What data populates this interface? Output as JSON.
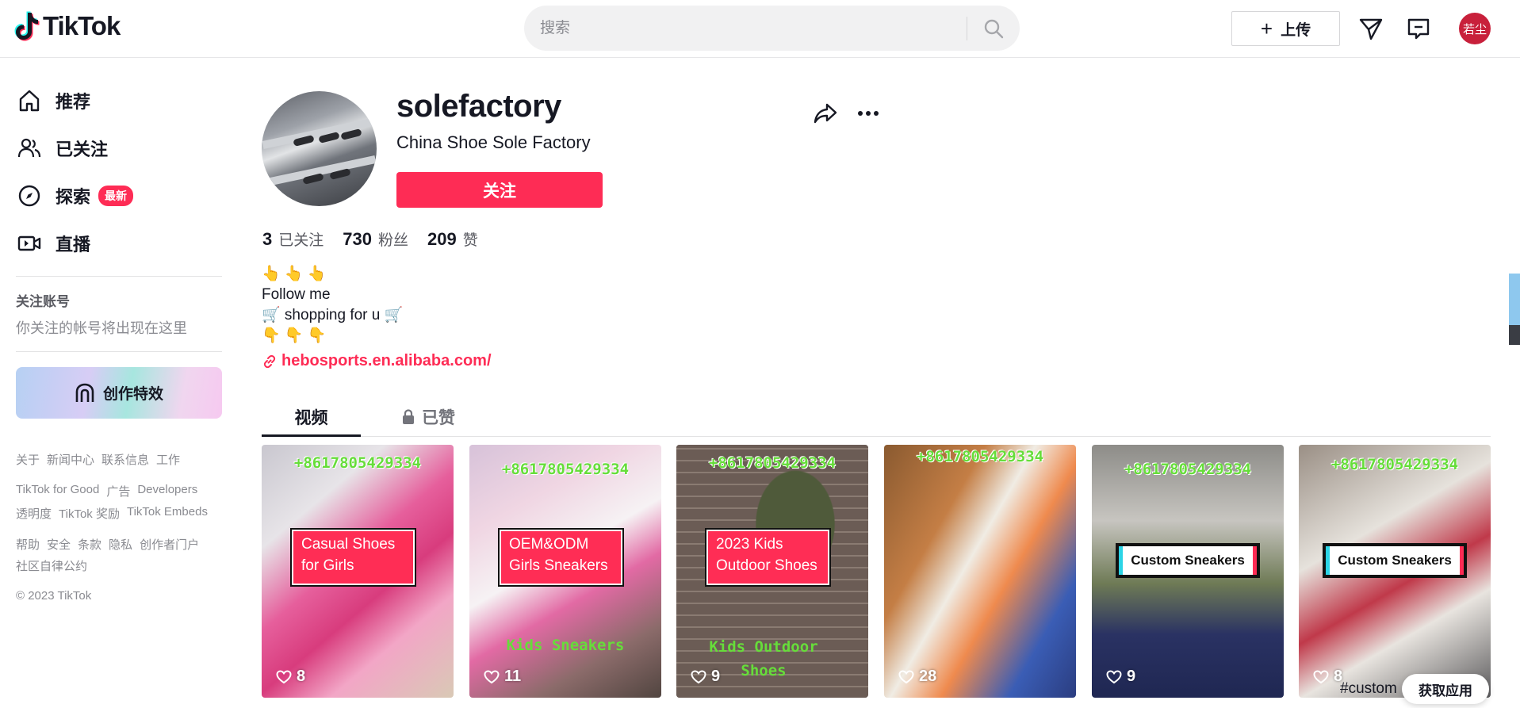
{
  "header": {
    "logo_text": "TikTok",
    "search_placeholder": "搜索",
    "upload_label": "上传",
    "user_avatar_text": "若尘"
  },
  "sidebar": {
    "nav": [
      {
        "label": "推荐",
        "icon": "home-icon"
      },
      {
        "label": "已关注",
        "icon": "following-icon"
      },
      {
        "label": "探索",
        "icon": "compass-icon",
        "badge": "最新"
      },
      {
        "label": "直播",
        "icon": "live-icon"
      }
    ],
    "following_title": "关注账号",
    "following_hint": "你关注的帐号将出现在这里",
    "effects_label": "创作特效",
    "footer_rows": [
      [
        "关于",
        "新闻中心",
        "联系信息",
        "工作"
      ],
      [
        "TikTok for Good",
        "广告",
        "Developers"
      ],
      [
        "透明度",
        "TikTok 奖励",
        "TikTok Embeds"
      ],
      [
        "帮助",
        "安全",
        "条款",
        "隐私",
        "创作者门户"
      ],
      [
        "社区自律公约"
      ]
    ],
    "copyright": "© 2023 TikTok"
  },
  "profile": {
    "username": "solefactory",
    "nickname": "China Shoe Sole Factory",
    "follow_label": "关注",
    "stats": [
      {
        "num": "3",
        "label": "已关注"
      },
      {
        "num": "730",
        "label": "粉丝"
      },
      {
        "num": "209",
        "label": "赞"
      }
    ],
    "bio_lines": [
      "👆 👆 👆",
      "Follow me",
      "🛒 shopping for u 🛒",
      "👇 👇 👇"
    ],
    "link": "hebosports.en.alibaba.com/"
  },
  "tabs": {
    "videos": "视频",
    "liked": "已赞"
  },
  "videos": [
    {
      "top": "+8617805429334",
      "caption": "Casual Shoes for Girls",
      "likes": "8",
      "bg": "pink"
    },
    {
      "top": "+8617805429334",
      "caption": "OEM&ODM Girls Sneakers",
      "bottom": "Kids Sneakers",
      "likes": "11",
      "bg": "pinkwhite"
    },
    {
      "top": "+8617805429334",
      "caption": "2023 Kids Outdoor Shoes",
      "bottom": "Kids Outdoor Shoes",
      "likes": "9",
      "bg": "brick"
    },
    {
      "top": "+8617805429334",
      "likes": "28",
      "bg": "orange"
    },
    {
      "top": "+8617805429334",
      "tag": "Custom Sneakers",
      "likes": "9",
      "bg": "flag"
    },
    {
      "top": "+8617805429334",
      "tag": "Custom Sneakers",
      "likes": "8",
      "bg": "redshoe"
    }
  ],
  "overlay": {
    "hashtag": "#custom",
    "get_app": "获取应用"
  },
  "colors": {
    "accent": "#fe2c55",
    "text": "#161823",
    "muted": "#8a8b91"
  }
}
